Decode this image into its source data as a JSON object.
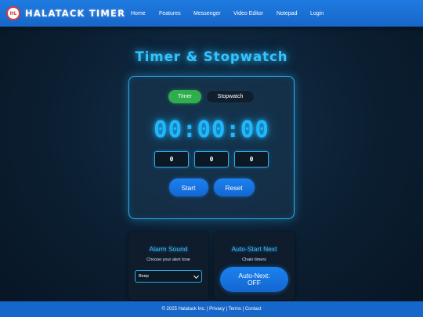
{
  "header": {
    "logo_text": "HL",
    "brand": "HALATACK TIMER",
    "nav": [
      "Home",
      "Features",
      "Messenger",
      "Video Editor",
      "Notepad",
      "Login"
    ]
  },
  "page": {
    "title": "Timer & Stopwatch"
  },
  "timer": {
    "modes": {
      "timer": "Timer",
      "stopwatch": "Stopwatch",
      "active": "Timer"
    },
    "display": "00:00:00",
    "inputs": {
      "hours": "0",
      "minutes": "0",
      "seconds": "0"
    },
    "start_label": "Start",
    "reset_label": "Reset"
  },
  "alarm": {
    "title": "Alarm Sound",
    "subtitle": "Choose your alert tone",
    "selected": "Beep"
  },
  "auto_start": {
    "title": "Auto-Start Next",
    "subtitle": "Chain timers",
    "button_line1": "Auto-Next:",
    "button_line2": "OFF"
  },
  "footer": {
    "text": "© 2025 Halatack Inc. | Privacy | Terms | Contact"
  },
  "colors": {
    "header_blue": "#1766c9",
    "neon_cyan": "#33c4ff",
    "timer_green": "#2fae4e",
    "button_blue": "#1b82f0"
  }
}
